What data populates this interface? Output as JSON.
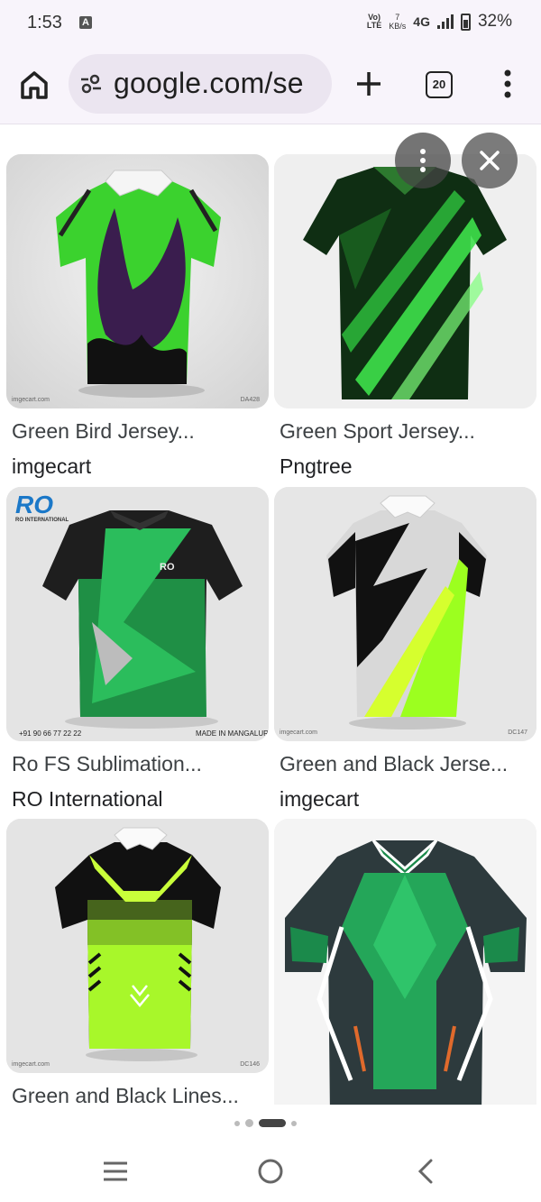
{
  "status_bar": {
    "time": "1:53",
    "notif_letter": "A",
    "volte_top": "Vo)",
    "volte_bottom": "LTE",
    "speed_value": "7",
    "speed_unit": "KB/s",
    "network": "4G",
    "battery": "32%"
  },
  "browser": {
    "url": "google.com/se",
    "tab_count": "20"
  },
  "results": [
    {
      "title": "Green Bird Jersey...",
      "source": "imgecart",
      "watermark_left": "imgecart.com",
      "watermark_right": "DA428"
    },
    {
      "title": "Green Sport Jersey...",
      "source": "Pngtree"
    },
    {
      "title": "Ro FS Sublimation...",
      "source": "RO International",
      "logo_text": "RO",
      "logo_sub": "RO INTERNATIONAL",
      "shirt_logo": "RO",
      "phone": "+91 90 66 77 22 22",
      "made_in": "MADE IN MANGALURU"
    },
    {
      "title": "Green and Black Jerse...",
      "source": "imgecart",
      "watermark_left": "imgecart.com",
      "watermark_right": "DC147"
    },
    {
      "title": "Green and Black Lines...",
      "source": "",
      "watermark_left": "imgecart.com",
      "watermark_right": "DC146"
    },
    {
      "title": "",
      "source": ""
    }
  ],
  "colors": {
    "chrome_bg": "#f8f4fb",
    "omnibox_bg": "#ebe5f0",
    "jersey_green": "#3bd22e",
    "lime": "#b6ff1f"
  },
  "icons": [
    "home-icon",
    "tune-icon",
    "plus-icon",
    "tabs-icon",
    "more-vert-icon",
    "close-icon",
    "menu-icon",
    "circle-home-icon",
    "back-icon"
  ]
}
